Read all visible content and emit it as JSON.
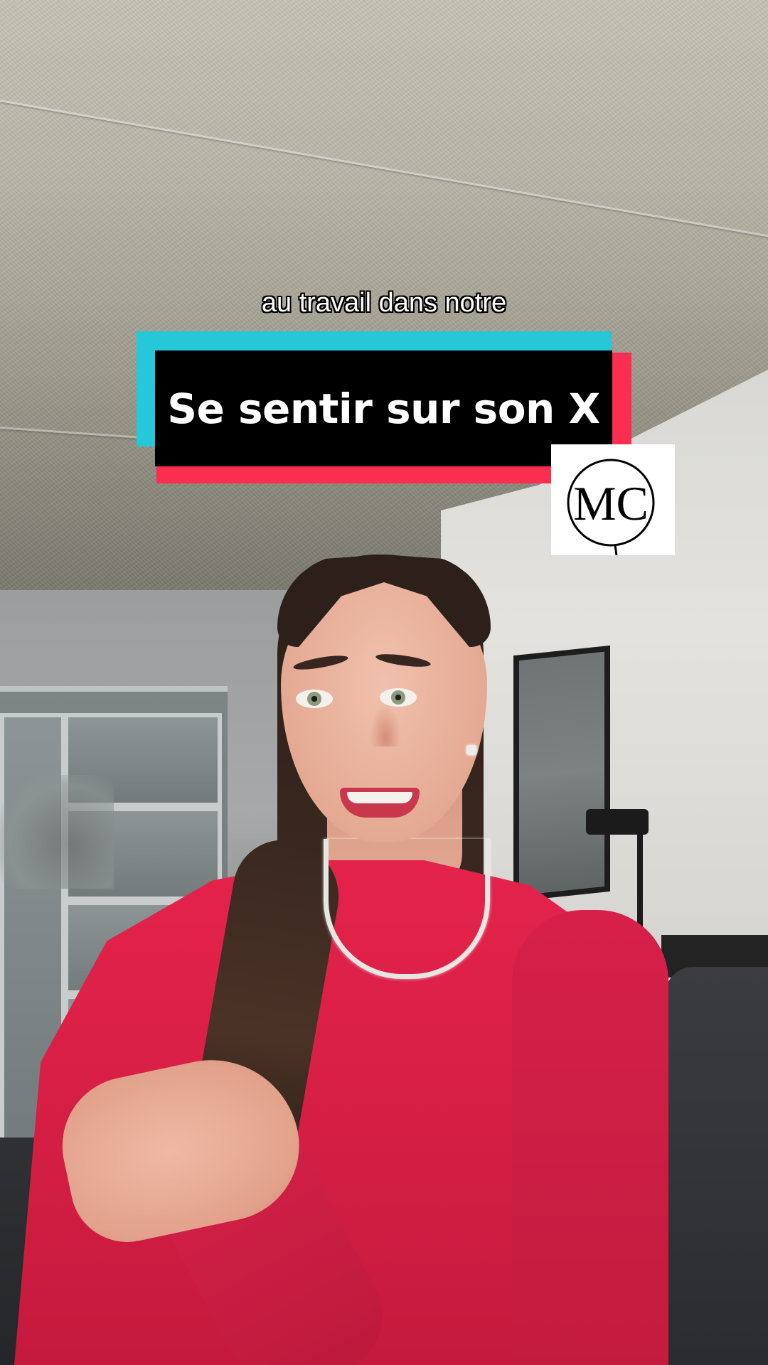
{
  "overlay": {
    "caption_line_1": "au travail dans notre",
    "title": "Se sentir sur son X"
  },
  "logo": {
    "text": "MC",
    "background_color": "#ffffff",
    "ink_color": "#000000"
  },
  "colors": {
    "title_background": "#000000",
    "title_accent_cyan": "#25c8d8",
    "title_accent_red": "#fb2e52",
    "shirt": "#d81f45"
  }
}
